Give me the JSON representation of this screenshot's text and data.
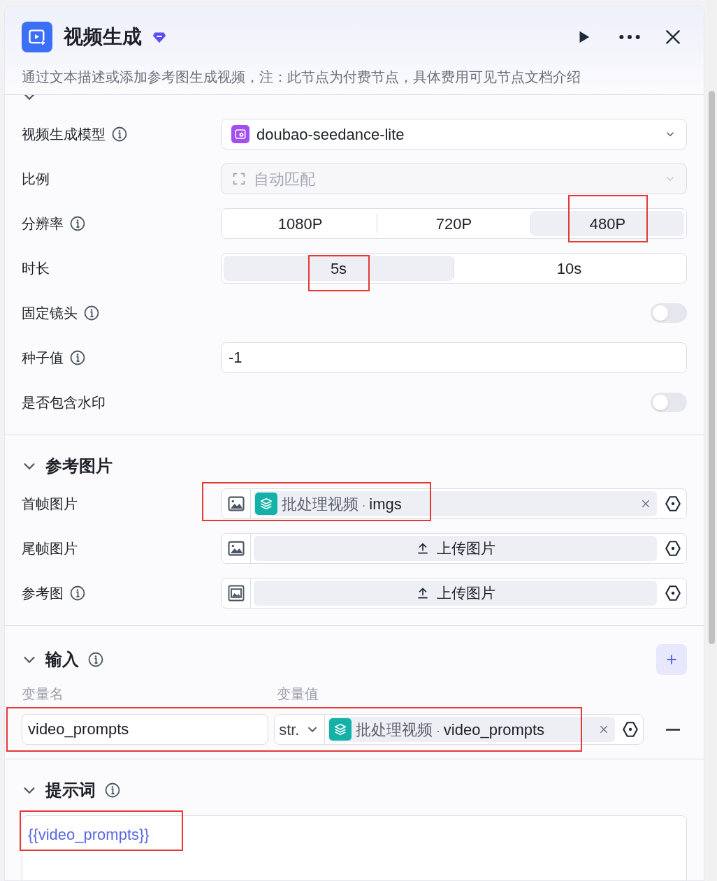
{
  "header": {
    "title": "视频生成",
    "premium": true,
    "description": "通过文本描述或添加参考图生成视频，注：此节点为付费节点，具体费用可见节点文档介绍"
  },
  "sections": [
    {
      "expanded": true,
      "rows": [
        {
          "kind": "select",
          "label": "视频生成模型",
          "info": true,
          "value": "doubao-seedance-lite",
          "disabled": false
        },
        {
          "kind": "select",
          "label": "比例",
          "info": false,
          "value": "自动匹配",
          "disabled": true
        },
        {
          "kind": "segmented",
          "label": "分辨率",
          "info": true,
          "options": [
            {
              "label": "1080P",
              "selected": false,
              "highlighted": false
            },
            {
              "label": "720P",
              "selected": false,
              "highlighted": false
            },
            {
              "label": "480P",
              "selected": true,
              "highlighted": true
            }
          ]
        },
        {
          "kind": "segmented",
          "label": "时长",
          "info": false,
          "options": [
            {
              "label": "5s",
              "selected": true,
              "highlighted": true
            },
            {
              "label": "10s",
              "selected": false,
              "highlighted": false
            }
          ]
        },
        {
          "kind": "toggle",
          "label": "固定镜头",
          "info": true,
          "on": false
        },
        {
          "kind": "text",
          "label": "种子值",
          "info": true,
          "value": "-1"
        },
        {
          "kind": "toggle",
          "label": "是否包含水印",
          "info": false,
          "on": false
        }
      ]
    },
    {
      "title": "参考图片",
      "expanded": true,
      "rows": [
        {
          "kind": "image",
          "label": "首帧图片",
          "info": false,
          "highlighted": true,
          "reference": {
            "source": "批处理视频",
            "separator": "·",
            "field": "imgs"
          }
        },
        {
          "kind": "image",
          "label": "尾帧图片",
          "info": false,
          "highlighted": false,
          "upload": "上传图片"
        },
        {
          "kind": "image",
          "label": "参考图",
          "info": true,
          "highlighted": false,
          "upload": "上传图片"
        }
      ]
    }
  ],
  "inputs": {
    "title": "输入",
    "expanded": true,
    "columns": [
      "变量名",
      "变量值"
    ],
    "rows": [
      {
        "name": "video_prompts",
        "type": "str.",
        "source": "批处理视频",
        "separator": "·",
        "field": "video_prompts",
        "highlighted": true
      }
    ]
  },
  "prompt": {
    "title": "提示词",
    "expanded": true,
    "value": "{{video_prompts}}",
    "highlighted": true
  }
}
